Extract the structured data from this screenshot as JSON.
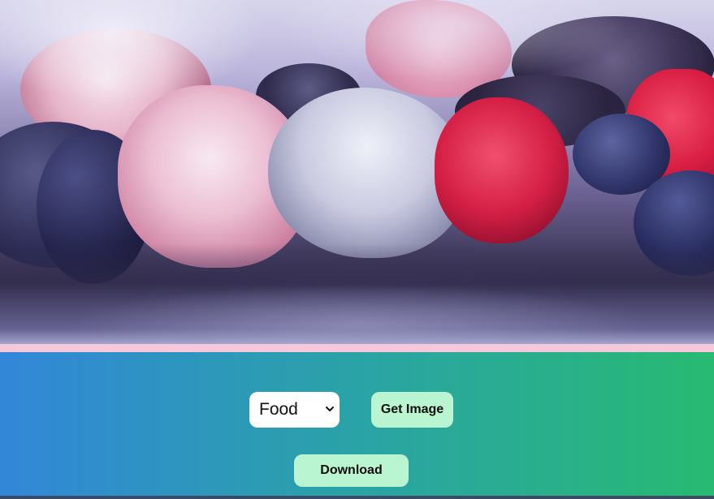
{
  "hero": {
    "image_description": "",
    "divider_color": "#f6c8dc"
  },
  "controls": {
    "gradient_start": "#3287d8",
    "gradient_end": "#28ba72",
    "category_select": {
      "selected": "Food",
      "icon": "chevron-down-icon"
    },
    "get_image_label": "Get Image",
    "download_label": "Download",
    "button_color": "#b9f5d0"
  }
}
